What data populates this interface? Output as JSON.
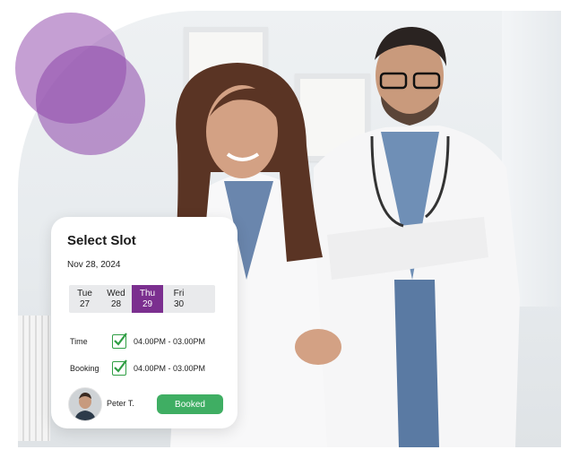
{
  "card": {
    "title": "Select Slot",
    "date": "Nov 28, 2024",
    "days": [
      {
        "name": "Tue",
        "num": "27",
        "selected": false
      },
      {
        "name": "Wed",
        "num": "28",
        "selected": false
      },
      {
        "name": "Thu",
        "num": "29",
        "selected": true
      },
      {
        "name": "Fri",
        "num": "30",
        "selected": false
      }
    ],
    "time_label": "Time",
    "time_value": "04.00PM - 03.00PM",
    "booking_label": "Booking",
    "booking_value": "04.00PM - 03.00PM",
    "person_name": "Peter T.",
    "status_button": "Booked"
  },
  "colors": {
    "accent_purple": "#7b2f8f",
    "bubble_purple": "#9650af",
    "booked_green": "#3fae63",
    "check_green": "#2f9e44"
  },
  "icons": [
    "check-icon",
    "avatar-photo",
    "doctor-photo"
  ]
}
